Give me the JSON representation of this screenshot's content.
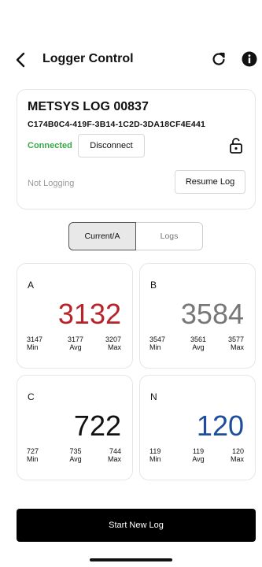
{
  "header": {
    "title": "Logger Control"
  },
  "device": {
    "name": "METSYS LOG 00837",
    "id": "C174B0C4-419F-3B14-1C2D-3DA18CF4E441",
    "connection_status": "Connected",
    "disconnect_label": "Disconnect",
    "logging_status": "Not Logging",
    "resume_label": "Resume Log"
  },
  "tabs": [
    {
      "label": "Current/A",
      "active": true
    },
    {
      "label": "Logs",
      "active": false
    }
  ],
  "meters": {
    "a": {
      "label": "A",
      "value": "3132",
      "min": "3147",
      "avg": "3177",
      "max": "3207",
      "color": "#b8232a"
    },
    "b": {
      "label": "B",
      "value": "3584",
      "min": "3547",
      "avg": "3561",
      "max": "3577",
      "color": "#777777"
    },
    "c": {
      "label": "C",
      "value": "722",
      "min": "727",
      "avg": "735",
      "max": "744",
      "color": "#111111"
    },
    "n": {
      "label": "N",
      "value": "120",
      "min": "119",
      "avg": "119",
      "max": "120",
      "color": "#1d4e9e"
    }
  },
  "stat_labels": {
    "min": "Min",
    "avg": "Avg",
    "max": "Max"
  },
  "start_label": "Start New Log",
  "colors": {
    "connected": "#3aa84a",
    "button_bg": "#000000"
  },
  "icons": [
    "back-arrow-icon",
    "refresh-icon",
    "info-icon",
    "unlocked-padlock-icon"
  ]
}
